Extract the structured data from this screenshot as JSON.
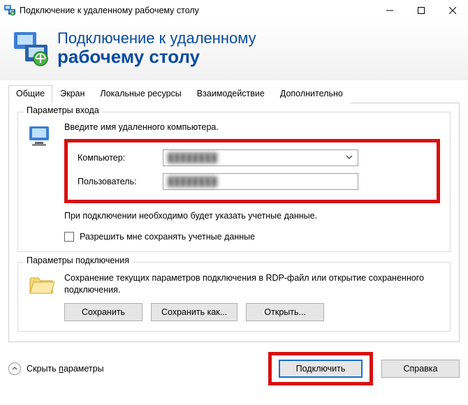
{
  "titlebar": {
    "title": "Подключение к удаленному рабочему столу"
  },
  "header": {
    "line1": "Подключение к удаленному",
    "line2": "рабочему столу"
  },
  "tabs": {
    "general": "Общие",
    "display": "Экран",
    "localres": "Локальные ресурсы",
    "experience": "Взаимодействие",
    "advanced": "Дополнительно"
  },
  "login_group": {
    "legend": "Параметры входа",
    "instruction": "Введите имя удаленного компьютера.",
    "computer_label": "Компьютер:",
    "computer_value": "████████",
    "user_label": "Пользователь:",
    "user_value": "████████",
    "note": "При подключении необходимо будет указать учетные данные.",
    "checkbox_label": "Разрешить мне сохранять учетные данные"
  },
  "conn_group": {
    "legend": "Параметры подключения",
    "desc": "Сохранение текущих параметров подключения в RDP-файл или открытие сохраненного подключения.",
    "save": "Сохранить",
    "save_as": "Сохранить как...",
    "open": "Открыть..."
  },
  "footer": {
    "hide_params_prefix": "Скрыть ",
    "hide_params_u": "п",
    "hide_params_suffix": "араметры",
    "connect_prefix": "",
    "connect_u": "П",
    "connect_suffix": "одключить",
    "help": "Справка"
  }
}
